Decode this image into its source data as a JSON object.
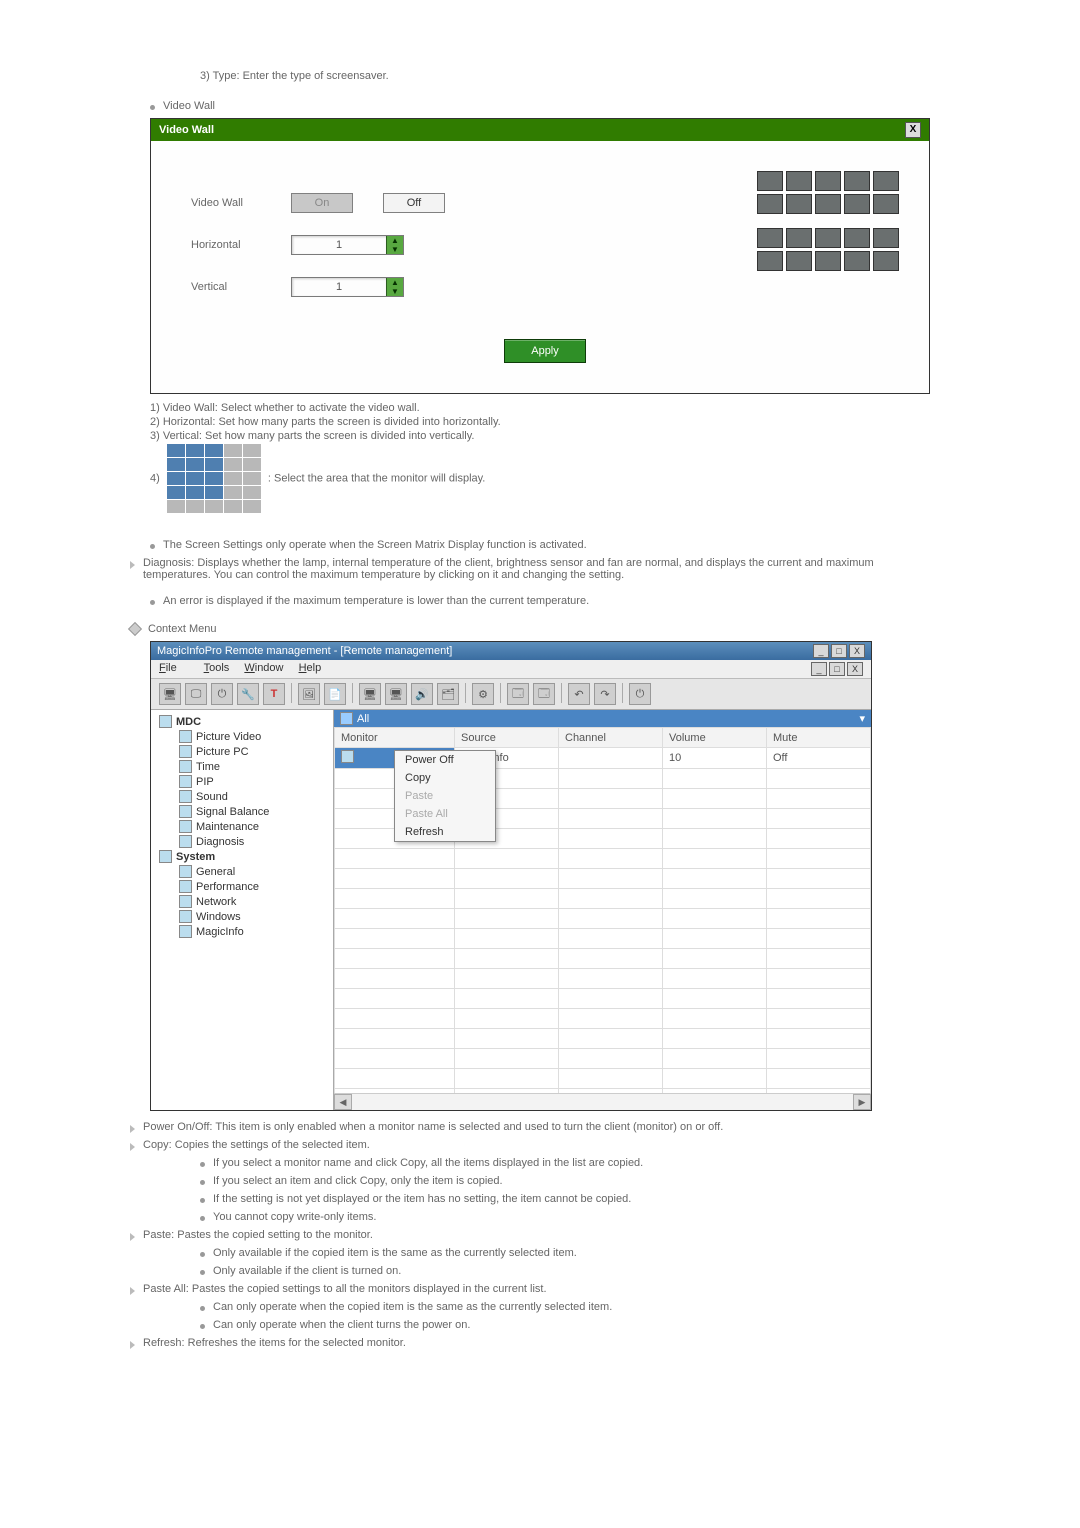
{
  "doc": {
    "type_line": "3) Type: Enter the type of screensaver.",
    "video_wall_label": "Video Wall",
    "screen_settings_note": "The Screen Settings only operate when the Screen Matrix Display function is activated.",
    "diagnosis": "Diagnosis: Displays whether the lamp, internal temperature of the client, brightness sensor and fan are normal, and displays the current and maximum temperatures. You can control the maximum temperature by clicking on it and changing the setting.",
    "diagnosis_sub": "An error is displayed if the maximum temperature is lower than the current temperature.",
    "context_menu_heading": "Context Menu",
    "ctx_notes": {
      "power": "Power On/Off: This item is only enabled when a monitor name is selected and used to turn the client (monitor) on or off.",
      "copy": "Copy: Copies the settings of the selected item.",
      "copy_subs": [
        "If you select a monitor name and click Copy, all the items displayed in the list are copied.",
        "If you select an item and click Copy, only the item is copied.",
        "If the setting is not yet displayed or the item has no setting, the item cannot be copied.",
        "You cannot copy write-only items."
      ],
      "paste": "Paste: Pastes the copied setting to the monitor.",
      "paste_subs": [
        "Only available if the copied item is the same as the currently selected item.",
        "Only available if the client is turned on."
      ],
      "paste_all": "Paste All: Pastes the copied settings to all the monitors displayed in the current list.",
      "paste_all_subs": [
        "Can only operate when the copied item is the same as the currently selected item.",
        "Can only operate when the client turns the power on."
      ],
      "refresh": "Refresh: Refreshes the items for the selected monitor."
    }
  },
  "video_wall": {
    "title": "Video Wall",
    "row_label": "Video Wall",
    "on": "On",
    "off": "Off",
    "horizontal_label": "Horizontal",
    "horizontal_value": "1",
    "vertical_label": "Vertical",
    "vertical_value": "1",
    "apply": "Apply",
    "notes": {
      "n1": "1) Video Wall: Select whether to activate the video wall.",
      "n2": "2) Horizontal: Set how many parts the screen is divided into horizontally.",
      "n3": "3) Vertical: Set how many parts the screen is divided into vertically.",
      "n4_prefix": "4) ",
      "n4_suffix": " : Select the area that the monitor will display."
    }
  },
  "app": {
    "title": "MagicInfoPro Remote management - [Remote management]",
    "menu": {
      "file": "File",
      "tools": "Tools",
      "window": "Window",
      "help": "Help"
    },
    "window_btns": {
      "min": "_",
      "max": "□",
      "close": "X",
      "sub_min": "_",
      "sub_max": "□",
      "sub_close": "X"
    },
    "tree": {
      "root": "MDC",
      "mdc_items": [
        "Picture Video",
        "Picture PC",
        "Time",
        "PIP",
        "Sound",
        "Signal Balance",
        "Maintenance",
        "Diagnosis"
      ],
      "system": "System",
      "system_items": [
        "General",
        "Performance",
        "Network",
        "Windows",
        "MagicInfo"
      ]
    },
    "list": {
      "all": "All",
      "headers": [
        "Monitor",
        "Source",
        "Channel",
        "Volume",
        "Mute"
      ],
      "row": {
        "monitor_icon": "MagicInfo",
        "source": "MagicInfo",
        "channel": "",
        "volume": "10",
        "mute": "Off"
      }
    },
    "context_menu": {
      "items": [
        {
          "label": "Power Off",
          "enabled": true
        },
        {
          "label": "Copy",
          "enabled": true
        },
        {
          "label": "Paste",
          "enabled": false
        },
        {
          "label": "Paste All",
          "enabled": false
        },
        {
          "label": "Refresh",
          "enabled": true
        }
      ]
    }
  }
}
